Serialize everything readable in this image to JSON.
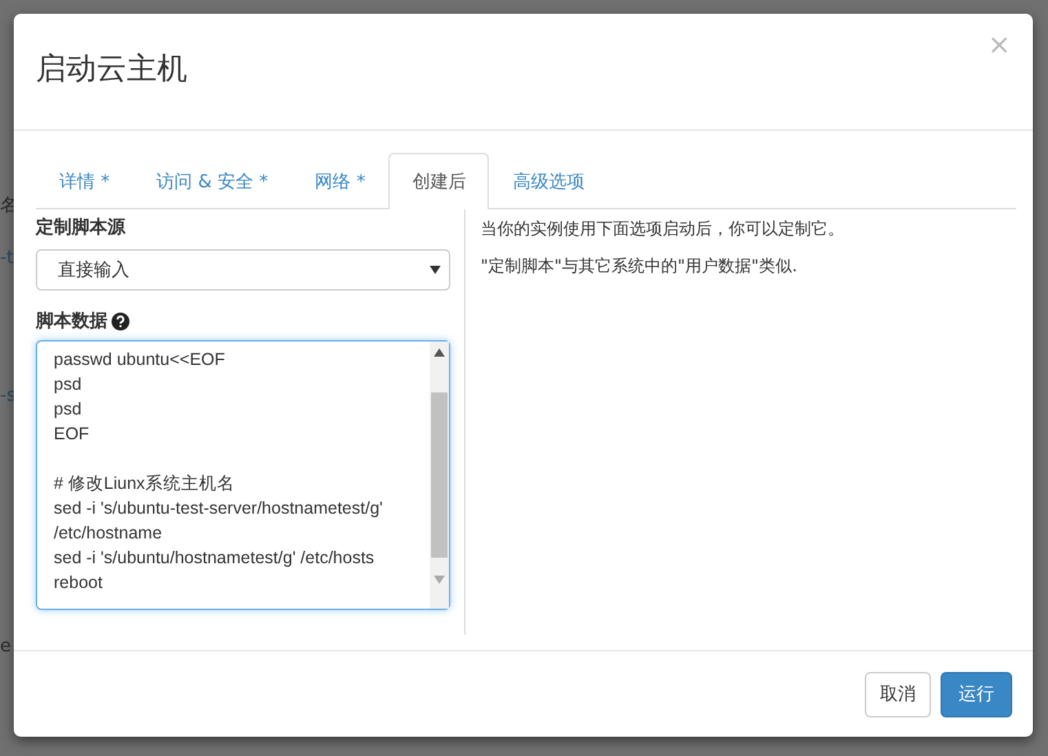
{
  "background_page": {
    "fragments": [
      "名",
      "-t",
      "-s",
      "e"
    ]
  },
  "dialog": {
    "title": "启动云主机",
    "close": "×"
  },
  "tabs": [
    {
      "label": "详情 *",
      "selected": false
    },
    {
      "label": "访问 & 安全 *",
      "selected": false
    },
    {
      "label": "网络 *",
      "selected": false
    },
    {
      "label": "创建后",
      "selected": true
    },
    {
      "label": "高级选项",
      "selected": false
    }
  ],
  "form": {
    "source_label": "定制脚本源",
    "source_value": "直接输入",
    "script_label": "脚本数据",
    "script_value": "passwd ubuntu<<EOF\npsd\npsd\nEOF\n\n# 修改Liunx系统主机名\nsed -i 's/ubuntu-test-server/hostnametest/g'\n/etc/hostname\nsed -i 's/ubuntu/hostnametest/g' /etc/hosts\nreboot"
  },
  "help": [
    "当你的实例使用下面选项启动后，你可以定制它。",
    "\"定制脚本\"与其它系统中的\"用户数据\"类似."
  ],
  "buttons": [
    {
      "label": "取消",
      "kind": "default"
    },
    {
      "label": "运行",
      "kind": "primary"
    }
  ]
}
